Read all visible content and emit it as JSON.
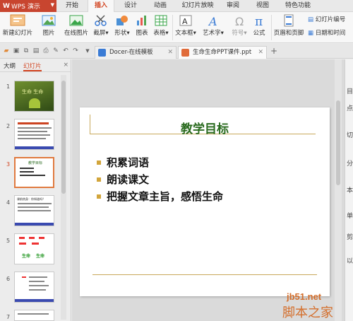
{
  "app": {
    "name": "WPS 演示",
    "logo": "W"
  },
  "menu": [
    "开始",
    "插入",
    "设计",
    "动画",
    "幻灯片放映",
    "审阅",
    "视图",
    "特色功能"
  ],
  "menu_active": "插入",
  "ribbon": {
    "new_slide": "新建幻灯片",
    "picture": "图片",
    "online_picture": "在线图片",
    "screenshot": "截屏",
    "shape": "形状",
    "chart": "图表",
    "table": "表格",
    "textbox": "文本框",
    "wordart": "艺术字",
    "symbol": "符号",
    "formula": "公式",
    "header_footer": "页眉和页脚",
    "slide_number": "幻灯片编号",
    "date_time": "日期和时间"
  },
  "tabs": [
    {
      "label": "Docer-在线模板"
    },
    {
      "label": "生命生命PPT课件.ppt"
    }
  ],
  "left_panel": {
    "tab_outline": "大纲",
    "tab_slides": "幻灯片",
    "close": "×"
  },
  "thumbnails": [
    "1",
    "2",
    "3",
    "4",
    "5",
    "6",
    "7"
  ],
  "slide": {
    "title": "教学目标",
    "bullets": [
      "积累词语",
      "朗读课文",
      "把握文章主旨，感悟生命"
    ]
  },
  "thumb_text": {
    "t1": "生命  生命",
    "t3": "教学目标",
    "t4": "课前热身：你知道吗？",
    "t5a": "生命",
    "t5b": "生命"
  },
  "right_pane": [
    "目",
    "点",
    "切",
    "分",
    "本",
    "单",
    "剪",
    "以"
  ],
  "watermark": {
    "site": "jb51.net",
    "name": "脚本之家"
  },
  "colors": {
    "accent": "#d2431f",
    "app": "#c8452f",
    "title": "#2a6b1f",
    "bullet": "#d2a53b"
  }
}
